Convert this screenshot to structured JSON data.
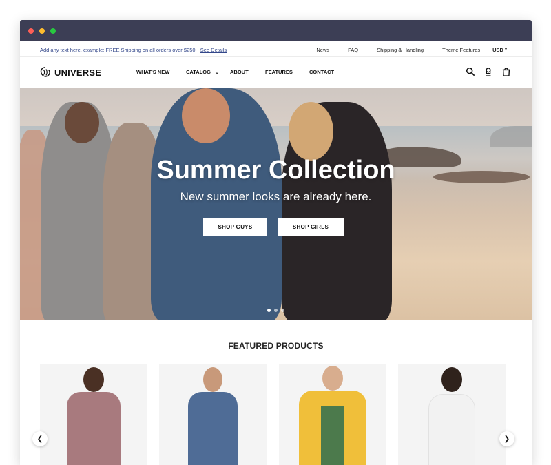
{
  "announcement": {
    "text": "Add any text here, example: FREE Shipping on all orders over $250.",
    "link": "See Details"
  },
  "top_links": [
    "News",
    "FAQ",
    "Shipping & Handling",
    "Theme Features"
  ],
  "currency": "USD",
  "brand": "UNIVERSE",
  "nav": {
    "items": [
      "WHAT'S NEW",
      "CATALOG",
      "ABOUT",
      "FEATURES",
      "CONTACT"
    ]
  },
  "hero": {
    "title": "Summer Collection",
    "subtitle": "New summer looks are already here.",
    "buttons": [
      "SHOP GUYS",
      "SHOP GIRLS"
    ],
    "slides": 3,
    "active_slide": 1
  },
  "featured": {
    "title": "FEATURED PRODUCTS"
  },
  "icons": {
    "search": "search-icon",
    "account": "account-icon",
    "cart": "cart-icon",
    "prev": "chevron-left-icon",
    "next": "chevron-right-icon"
  },
  "colors": {
    "titlebar": "#3c3e55",
    "announcement_text": "#33478a"
  }
}
